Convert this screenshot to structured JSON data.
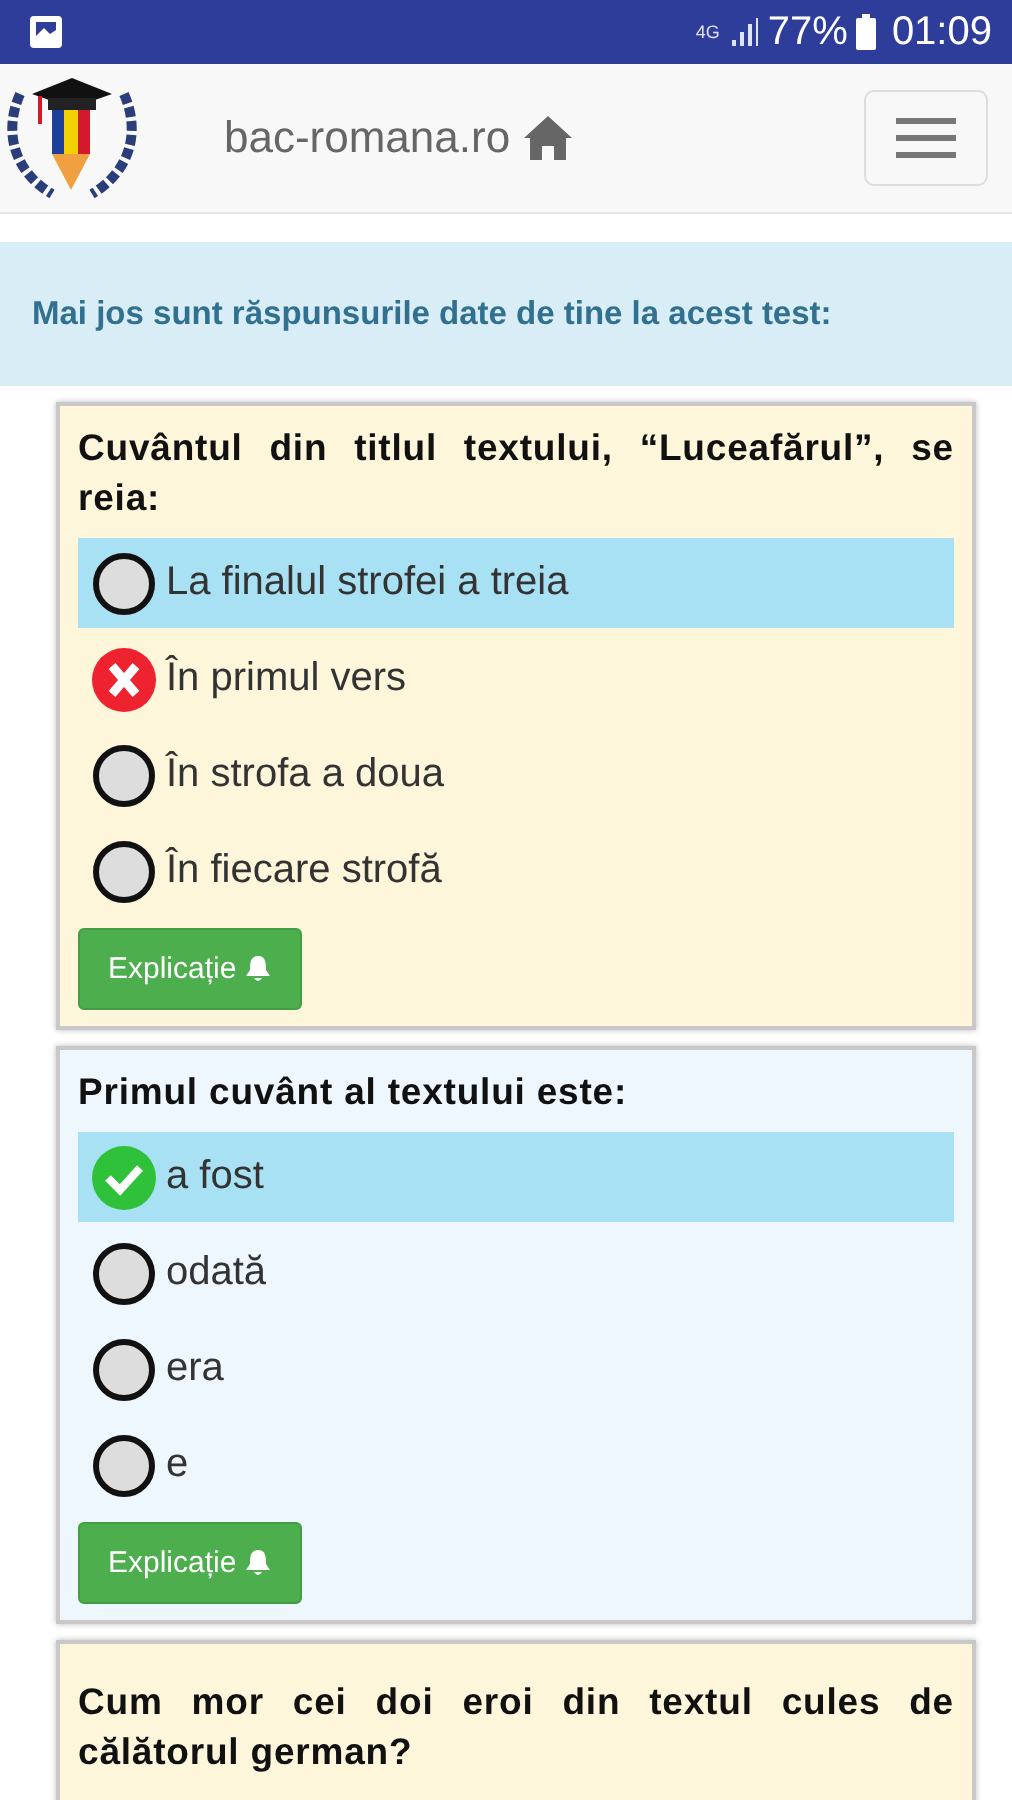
{
  "status_bar": {
    "network": "4G",
    "battery": "77%",
    "time": "01:09"
  },
  "header": {
    "site": "bac-romana.ro"
  },
  "notice": "Mai jos sunt răspunsurile date de tine la acest test:",
  "questions": [
    {
      "text": "Cuvântul din titlul textului, “Luceafărul”, se reia:",
      "correct": false,
      "button": "Explicație",
      "options": [
        {
          "text": "La finalul strofei a treia",
          "correct": true,
          "chosen": false
        },
        {
          "text": "În primul vers",
          "correct": false,
          "chosen": true
        },
        {
          "text": "În strofa a doua",
          "correct": false,
          "chosen": false
        },
        {
          "text": "În fiecare strofă",
          "correct": false,
          "chosen": false
        }
      ]
    },
    {
      "text": "Primul cuvânt al textului este:",
      "correct": true,
      "button": "Explicație",
      "options": [
        {
          "text": "a fost",
          "correct": true,
          "chosen": true
        },
        {
          "text": "odată",
          "correct": false,
          "chosen": false
        },
        {
          "text": "era",
          "correct": false,
          "chosen": false
        },
        {
          "text": "e",
          "correct": false,
          "chosen": false
        }
      ]
    },
    {
      "text": "Cum mor cei doi eroi din textul cules de călătorul german?",
      "correct": false
    }
  ]
}
